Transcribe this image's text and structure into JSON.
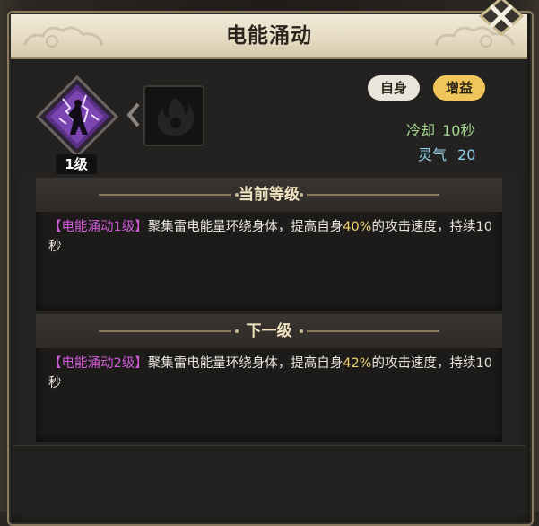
{
  "dialog": {
    "title": "电能涌动"
  },
  "skill": {
    "level_label": "1级",
    "icon": "lightning-fighter-icon",
    "next_icon": "flame-silhouette-icon"
  },
  "tags": [
    {
      "label": "自身",
      "color": "#e9e5da"
    },
    {
      "label": "增益",
      "color": "#f0c65a"
    }
  ],
  "stats": {
    "cooldown_label": "冷却",
    "cooldown_value": "10秒",
    "spirit_label": "灵气",
    "spirit_value": "20"
  },
  "current_level": {
    "header": "当前等级",
    "name": "【电能涌动1级】",
    "text_before": "聚集雷电能量环绕身体，提高自身",
    "percent": "40%",
    "text_after": "的攻击速度，持续10秒"
  },
  "next_level": {
    "header": "下一级",
    "name": "【电能涌动2级】",
    "text_before": "聚集雷电能量环绕身体，提高自身",
    "percent": "42%",
    "text_after": "的攻击速度，持续10秒"
  },
  "colors": {
    "skill_name": "#d05ad8",
    "percent": "#f0d070",
    "cooldown": "#9fd88d",
    "spirit": "#8fd0ea"
  }
}
